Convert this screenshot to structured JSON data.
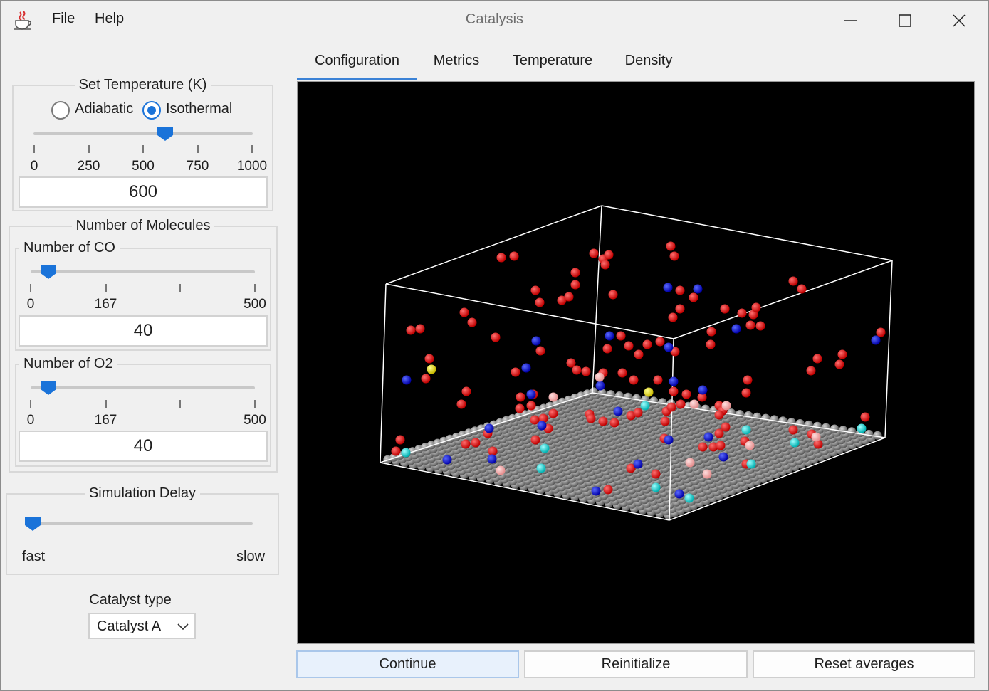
{
  "window": {
    "title": "Catalysis",
    "menu": [
      {
        "label": "File"
      },
      {
        "label": "Help"
      }
    ]
  },
  "temperature": {
    "group_label": "Set Temperature (K)",
    "modes": [
      {
        "label": "Adiabatic",
        "selected": false
      },
      {
        "label": "Isothermal",
        "selected": true
      }
    ],
    "slider": {
      "min": 0,
      "max": 1000,
      "value": 600,
      "ticks": [
        "0",
        "250",
        "500",
        "750",
        "1000"
      ]
    },
    "value": "600"
  },
  "molecules": {
    "group_label": "Number of Molecules",
    "co": {
      "label": "Number of CO",
      "slider": {
        "min": 0,
        "max": 500,
        "value": 40,
        "ticks": [
          "0",
          "167",
          "500"
        ]
      },
      "value": "40"
    },
    "o2": {
      "label": "Number of O2",
      "slider": {
        "min": 0,
        "max": 500,
        "value": 40,
        "ticks": [
          "0",
          "167",
          "500"
        ]
      },
      "value": "40"
    }
  },
  "delay": {
    "group_label": "Simulation Delay",
    "slider_fraction": 0.0,
    "min_label": "fast",
    "max_label": "slow"
  },
  "catalyst": {
    "label": "Catalyst type",
    "selected": "Catalyst A"
  },
  "tabs": [
    {
      "label": "Configuration",
      "active": true
    },
    {
      "label": "Metrics",
      "active": false
    },
    {
      "label": "Temperature",
      "active": false
    },
    {
      "label": "Density",
      "active": false
    }
  ],
  "buttons": {
    "continue": "Continue",
    "reinitialize": "Reinitialize",
    "reset": "Reset averages"
  },
  "colors": {
    "accent": "#1a73d9",
    "viewport_bg": "#000000",
    "surface_atom": "#8c8c8c",
    "oxygen": "#ee0000",
    "carbon": "#0000dd",
    "adsorbed_cyan": "#00d8d8",
    "adsorbed_pink": "#f4a8a8",
    "yellow": "#f0e000",
    "box_edge": "#ffffff"
  }
}
